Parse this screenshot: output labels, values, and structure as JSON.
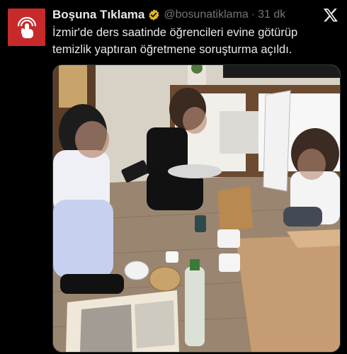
{
  "tweet": {
    "display_name": "Boşuna Tıklama",
    "handle": "@bosunatiklama",
    "separator": "·",
    "time": "31 dk",
    "text_line1": "İzmir'de ders saatinde öğrencileri evine götürüp",
    "text_line2": "temizlik yaptıran öğretmene soruşturma açıldı."
  },
  "icons": {
    "avatar": "hand-tap-logo-icon",
    "verified": "verified-badge-icon",
    "platform": "x-logo-icon"
  },
  "colors": {
    "background": "#000000",
    "text": "#e7e9ea",
    "secondary_text": "#71767b",
    "avatar_bg": "#c72a2a",
    "verified_badge": "#e2b719"
  }
}
